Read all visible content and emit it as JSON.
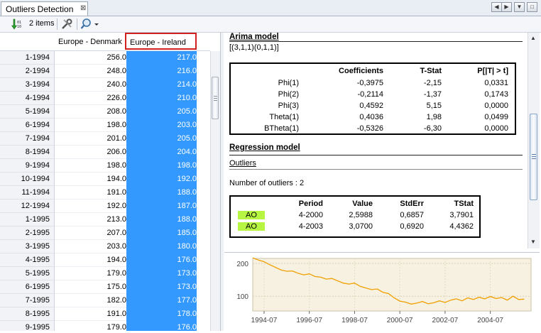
{
  "tab": {
    "title": "Outliers Detection",
    "close_glyph": "⊠"
  },
  "toolbar": {
    "items_label": "2 items"
  },
  "table": {
    "columns": [
      "Europe - Denmark",
      "Europe - Ireland"
    ],
    "rows": [
      {
        "period": "1-1994",
        "denmark": "256.0",
        "ireland": "217.0"
      },
      {
        "period": "2-1994",
        "denmark": "248.0",
        "ireland": "216.0"
      },
      {
        "period": "3-1994",
        "denmark": "240.0",
        "ireland": "214.0"
      },
      {
        "period": "4-1994",
        "denmark": "226.0",
        "ireland": "210.0"
      },
      {
        "period": "5-1994",
        "denmark": "208.0",
        "ireland": "205.0"
      },
      {
        "period": "6-1994",
        "denmark": "198.0",
        "ireland": "203.0"
      },
      {
        "period": "7-1994",
        "denmark": "201.0",
        "ireland": "205.0"
      },
      {
        "period": "8-1994",
        "denmark": "206.0",
        "ireland": "204.0"
      },
      {
        "period": "9-1994",
        "denmark": "198.0",
        "ireland": "198.0"
      },
      {
        "period": "10-1994",
        "denmark": "194.0",
        "ireland": "192.0"
      },
      {
        "period": "11-1994",
        "denmark": "191.0",
        "ireland": "188.0"
      },
      {
        "period": "12-1994",
        "denmark": "192.0",
        "ireland": "187.0"
      },
      {
        "period": "1-1995",
        "denmark": "213.0",
        "ireland": "188.0"
      },
      {
        "period": "2-1995",
        "denmark": "207.0",
        "ireland": "185.0"
      },
      {
        "period": "3-1995",
        "denmark": "203.0",
        "ireland": "180.0"
      },
      {
        "period": "4-1995",
        "denmark": "194.0",
        "ireland": "176.0"
      },
      {
        "period": "5-1995",
        "denmark": "179.0",
        "ireland": "173.0"
      },
      {
        "period": "6-1995",
        "denmark": "175.0",
        "ireland": "173.0"
      },
      {
        "period": "7-1995",
        "denmark": "182.0",
        "ireland": "177.0"
      },
      {
        "period": "8-1995",
        "denmark": "191.0",
        "ireland": "178.0"
      },
      {
        "period": "9-1995",
        "denmark": "179.0",
        "ireland": "176.0"
      }
    ]
  },
  "arima": {
    "title": "Arima model",
    "spec": "[(3,1,1)(0,1,1)]",
    "headers": [
      "",
      "Coefficients",
      "T-Stat",
      "P[|T| > t]"
    ],
    "rows": [
      [
        "Phi(1)",
        "-0,3975",
        "-2,15",
        "0,0331"
      ],
      [
        "Phi(2)",
        "-0,2114",
        "-1,37",
        "0,1743"
      ],
      [
        "Phi(3)",
        "0,4592",
        "5,15",
        "0,0000"
      ],
      [
        "Theta(1)",
        "0,4036",
        "1,98",
        "0,0499"
      ],
      [
        "BTheta(1)",
        "-0,5326",
        "-6,30",
        "0,0000"
      ]
    ]
  },
  "regression": {
    "title": "Regression model",
    "outliers_link": "Outliers",
    "count_text": "Number of outliers : 2",
    "headers": [
      "",
      "Period",
      "Value",
      "StdErr",
      "TStat"
    ],
    "rows": [
      [
        "AO",
        "4-2000",
        "2,5988",
        "0,6857",
        "3,7901"
      ],
      [
        "AO",
        "4-2003",
        "3,0700",
        "0,6920",
        "4,4362"
      ]
    ],
    "ao_color": "#b6f542"
  },
  "colors": {
    "selection": "#3399ff",
    "highlight_border": "#d12020",
    "series": "#f0a000"
  },
  "chart_data": {
    "type": "line",
    "title": "",
    "xlabel": "",
    "ylabel": "",
    "x_ticks": [
      "1994-07",
      "1996-07",
      "1998-07",
      "2000-07",
      "2002-07",
      "2004-07"
    ],
    "y_ticks": [
      100,
      200
    ],
    "ylim": [
      55,
      215
    ],
    "xlim": [
      1994.0,
      2006.3
    ],
    "series": [
      {
        "x": [
          1994.0,
          1994.25,
          1994.5,
          1994.75,
          1995.0,
          1995.25,
          1995.5,
          1995.75,
          1996.0,
          1996.25,
          1996.5,
          1996.75,
          1997.0,
          1997.25,
          1997.5,
          1997.75,
          1998.0,
          1998.25,
          1998.5,
          1998.75,
          1999.0,
          1999.25,
          1999.5,
          1999.75,
          2000.0,
          2000.25,
          2000.5,
          2000.75,
          2001.0,
          2001.25,
          2001.5,
          2001.75,
          2002.0,
          2002.25,
          2002.5,
          2002.75,
          2003.0,
          2003.25,
          2003.5,
          2003.75,
          2004.0,
          2004.25,
          2004.5,
          2004.75,
          2005.0,
          2005.25,
          2005.5,
          2005.75,
          2006.0
        ],
        "y": [
          217,
          210,
          205,
          196,
          188,
          180,
          176,
          177,
          170,
          165,
          168,
          160,
          158,
          152,
          154,
          147,
          140,
          137,
          140,
          130,
          125,
          120,
          122,
          112,
          108,
          95,
          85,
          82,
          76,
          79,
          84,
          77,
          80,
          86,
          81,
          88,
          92,
          86,
          95,
          90,
          97,
          92,
          99,
          93,
          96,
          88,
          100,
          90,
          91
        ]
      }
    ]
  }
}
